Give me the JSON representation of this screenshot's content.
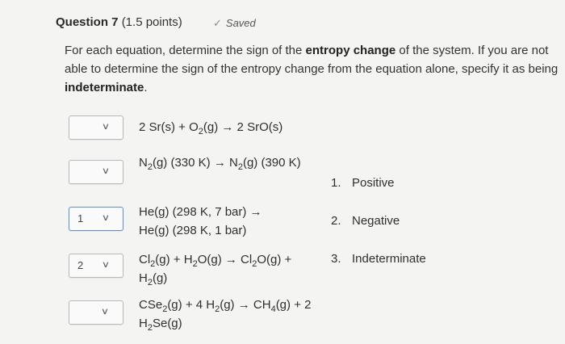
{
  "question": {
    "title": "Question 7",
    "points": "(1.5 points)",
    "status": "Saved",
    "status_icon": "check-icon"
  },
  "prompt": {
    "part1": "For each equation, determine the sign of the ",
    "bold1": "entropy change",
    "part2": " of the system. If you are not able to determine the sign of the entropy change from the equation alone, specify it as being ",
    "bold2": "indeterminate",
    "part3": "."
  },
  "rows": [
    {
      "selected": "",
      "eq": {
        "a": "2 Sr(s) + O",
        "a_sub": "2",
        "b": "(g) → 2 SrO(s)"
      }
    },
    {
      "selected": "",
      "eq": {
        "a": "N",
        "a_sub": "2",
        "b": "(g) (330 K) → N",
        "b_sub": "2",
        "c": "(g) (390 K)"
      }
    },
    {
      "selected": "1",
      "eq": {
        "a": "He(g) (298 K, 7 bar) → He(g) (298 K, 1 bar)"
      }
    },
    {
      "selected": "2",
      "eq": {
        "a": "Cl",
        "a_sub": "2",
        "b": "(g) + H",
        "b_sub": "2",
        "c": "O(g) → Cl",
        "c_sub": "2",
        "d": "O(g) + H",
        "d_sub": "2",
        "e": "(g)"
      }
    },
    {
      "selected": "",
      "eq": {
        "a": "CSe",
        "a_sub": "2",
        "b": "(g) + 4 H",
        "b_sub": "2",
        "c": "(g) → CH",
        "c_sub": "4",
        "d": "(g) + 2 H",
        "d_sub": "2",
        "e": "Se(g)"
      }
    }
  ],
  "options": [
    {
      "num": "1.",
      "label": "Positive"
    },
    {
      "num": "2.",
      "label": "Negative"
    },
    {
      "num": "3.",
      "label": "Indeterminate"
    }
  ],
  "dropdown_chevron": "chevron-down-icon",
  "colors": {
    "background": "#f4f4f2",
    "selected_border": "#5f8fd0",
    "check": "#8a8a8a"
  }
}
